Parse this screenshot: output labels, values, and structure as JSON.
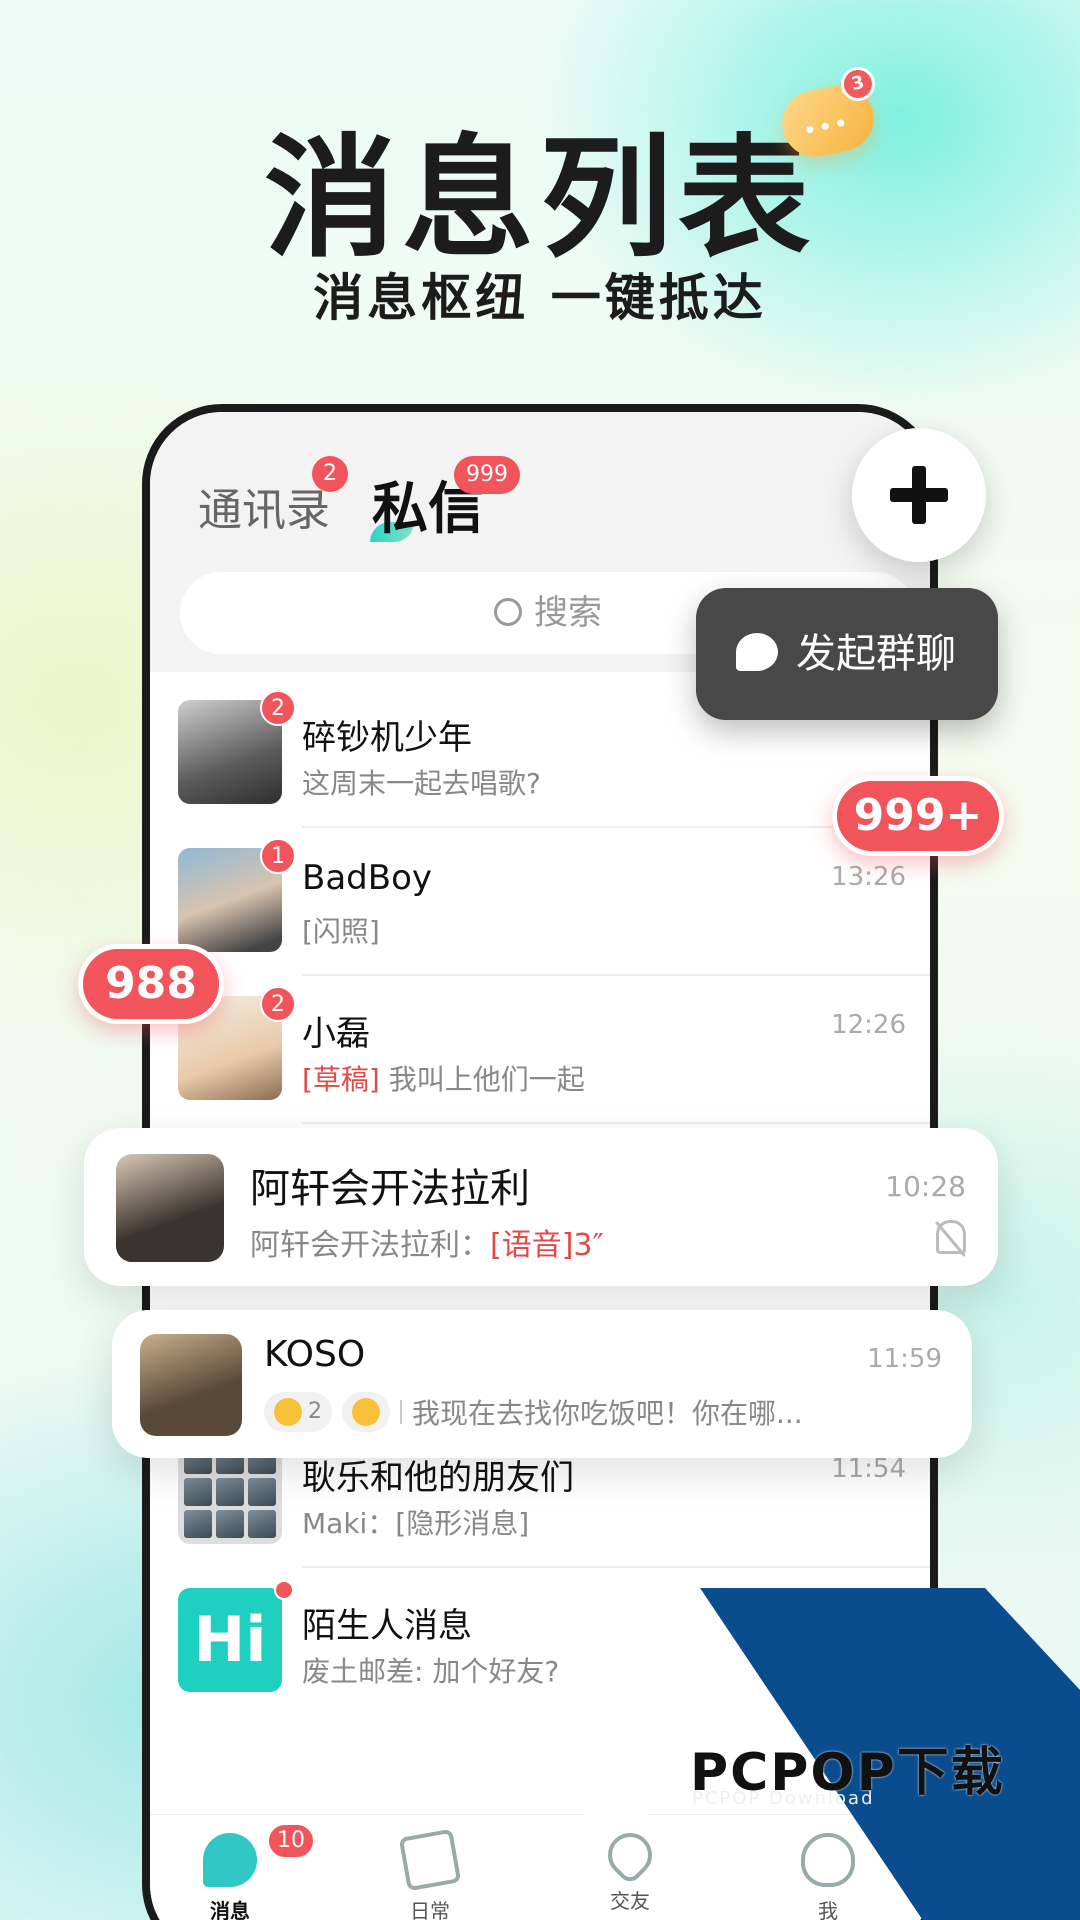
{
  "hero": {
    "title": "消息列表",
    "subtitle": "消息枢纽 一键抵达",
    "deco_badge": "3"
  },
  "header": {
    "tab_contacts": "通讯录",
    "tab_contacts_badge": "2",
    "tab_dm": "私信",
    "tab_dm_badge": "999",
    "search_placeholder": "搜索"
  },
  "fab": {
    "icon": "plus-icon"
  },
  "group_popup": {
    "label": "发起群聊",
    "icon": "group-chat-icon"
  },
  "floating_badges": {
    "top_right": "999+",
    "left": "988"
  },
  "conversations": [
    {
      "name": "碎钞机少年",
      "preview": "这周末一起去唱歌?",
      "badge": "2",
      "time": ""
    },
    {
      "name": "BadBoy",
      "preview": "[闪照]",
      "badge": "1",
      "time": "13:26"
    },
    {
      "name": "小磊",
      "draft_tag": "[草稿]",
      "preview": " 我叫上他们一起",
      "badge": "2",
      "time": "12:26"
    },
    {
      "name": "耿乐和他的朋友们",
      "preview": "Maki：[隐形消息]",
      "time": "11:54"
    },
    {
      "name": "陌生人消息",
      "preview": "废土邮差: 加个好友?",
      "avatar_text": "Hi"
    }
  ],
  "card_axuan": {
    "name": "阿轩会开法拉利",
    "preview": "阿轩会开法拉利：",
    "voice": "[语音]3″",
    "time": "10:28",
    "icon": "muted-bell-icon"
  },
  "card_koso": {
    "name": "KOSO",
    "time": "11:59",
    "reaction_count": "2",
    "preview": "我现在去找你吃饭吧！你在哪..."
  },
  "tabbar": [
    {
      "label": "消息",
      "badge": "10",
      "icon": "message-icon"
    },
    {
      "label": "日常",
      "icon": "daily-icon"
    },
    {
      "label": "交友",
      "icon": "friends-icon"
    },
    {
      "label": "我",
      "icon": "me-icon"
    }
  ],
  "watermark": {
    "brand": "PCPOP下载",
    "sub": "PCPOP Download"
  },
  "colors": {
    "badge_red": "#f2545b",
    "accent_teal": "#2fc6c4",
    "popup_dark": "#484848"
  }
}
